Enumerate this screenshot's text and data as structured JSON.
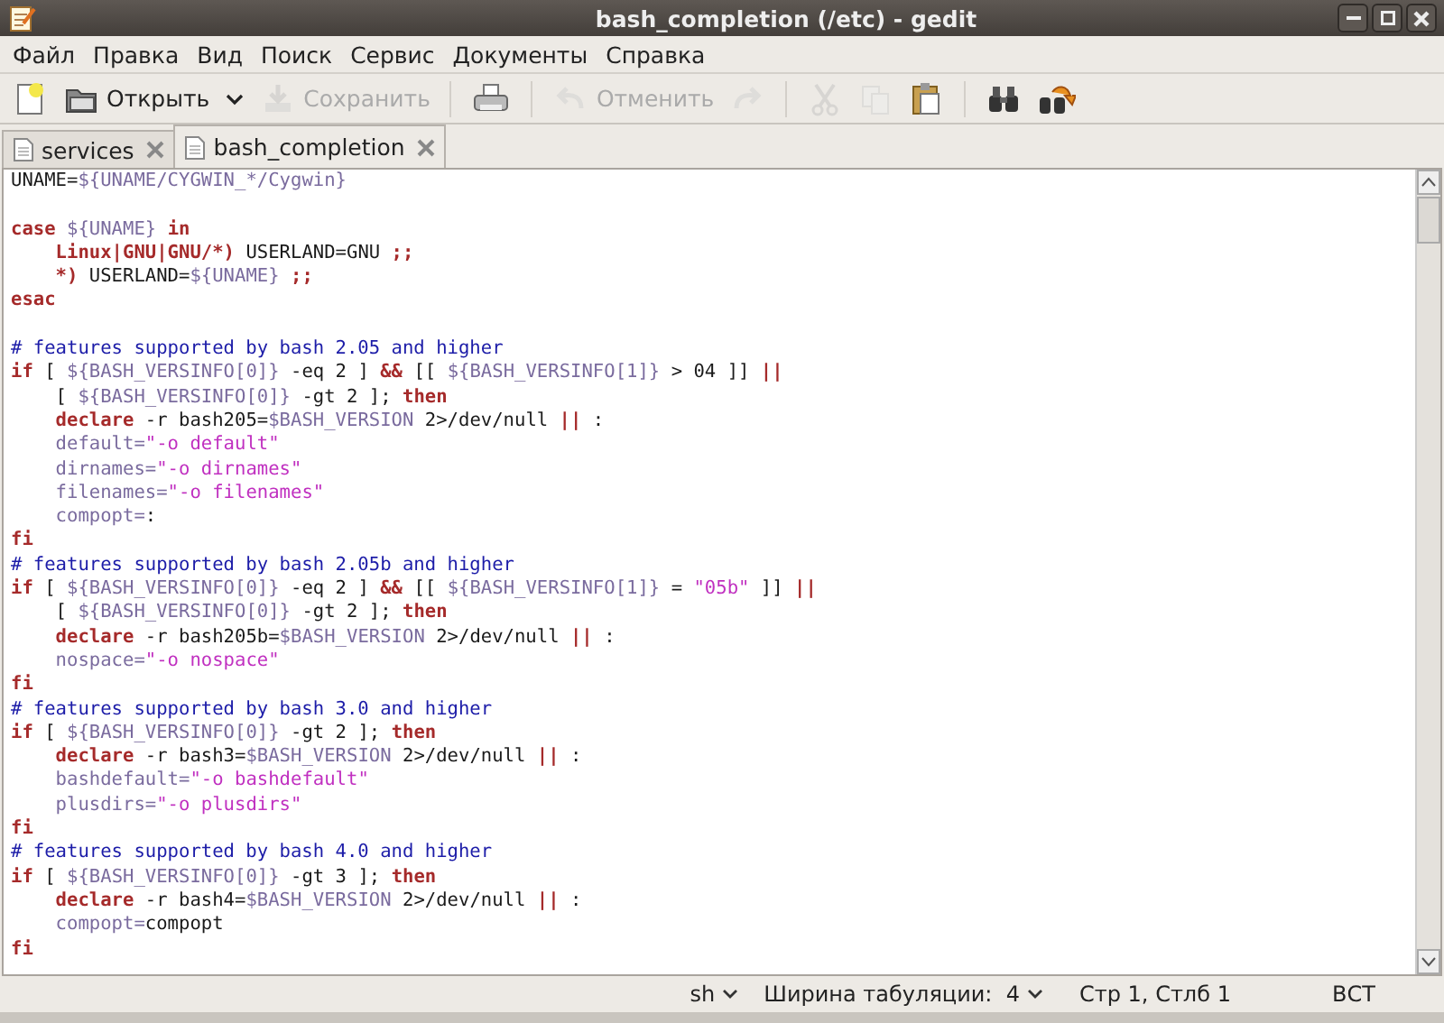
{
  "window": {
    "title": "bash_completion (/etc) - gedit"
  },
  "menu": [
    "Файл",
    "Правка",
    "Вид",
    "Поиск",
    "Сервис",
    "Документы",
    "Справка"
  ],
  "toolbar": [
    {
      "kind": "new",
      "disabled": false
    },
    {
      "kind": "open",
      "label": "Открыть",
      "disabled": false
    },
    {
      "kind": "save",
      "label": "Сохранить",
      "disabled": true
    },
    {
      "kind": "print",
      "disabled": false
    },
    {
      "kind": "undo",
      "label": "Отменить",
      "disabled": true
    },
    {
      "kind": "redo",
      "disabled": true
    },
    {
      "kind": "cut",
      "disabled": true
    },
    {
      "kind": "copy",
      "disabled": true
    },
    {
      "kind": "paste",
      "disabled": false
    },
    {
      "kind": "find",
      "disabled": false
    },
    {
      "kind": "replace",
      "disabled": false
    }
  ],
  "tabs": [
    {
      "label": "services",
      "selected": false
    },
    {
      "label": "bash_completion",
      "selected": true
    }
  ],
  "code": [
    {
      "kind": "code",
      "indent": false,
      "segments": [
        {
          "kind": "plain",
          "text": "UNAME="
        },
        {
          "kind": "var",
          "text": "${UNAME/CYGWIN_*/Cygwin}"
        }
      ]
    },
    {
      "kind": "blank"
    },
    {
      "kind": "code",
      "indent": false,
      "segments": [
        {
          "kind": "keyword",
          "text": "case"
        },
        {
          "kind": "var",
          "text": " ${UNAME} "
        },
        {
          "kind": "keyword",
          "text": "in"
        }
      ]
    },
    {
      "kind": "code",
      "indent": true,
      "segments": [
        {
          "kind": "keyword",
          "text": "Linux|GNU|GNU/*)"
        },
        {
          "kind": "plain",
          "text": " USERLAND=GNU "
        },
        {
          "kind": "keyword",
          "text": ";;"
        }
      ]
    },
    {
      "kind": "code",
      "indent": true,
      "segments": [
        {
          "kind": "keyword",
          "text": "*)"
        },
        {
          "kind": "plain",
          "text": " USERLAND="
        },
        {
          "kind": "var",
          "text": "${UNAME}"
        },
        {
          "kind": "keyword",
          "text": " ;;"
        }
      ]
    },
    {
      "kind": "code",
      "indent": false,
      "segments": [
        {
          "kind": "keyword",
          "text": "esac"
        }
      ]
    },
    {
      "kind": "blank"
    },
    {
      "kind": "code",
      "indent": false,
      "segments": [
        {
          "kind": "comment",
          "text": "# features supported by bash 2.05 and higher"
        }
      ]
    },
    {
      "kind": "code",
      "indent": false,
      "segments": [
        {
          "kind": "keyword",
          "text": "if"
        },
        {
          "kind": "plain",
          "text": " [ "
        },
        {
          "kind": "var",
          "text": "${BASH_VERSINFO[0]}"
        },
        {
          "kind": "plain",
          "text": " -eq 2 ] "
        },
        {
          "kind": "keyword",
          "text": "&&"
        },
        {
          "kind": "plain",
          "text": " [[ "
        },
        {
          "kind": "var",
          "text": "${BASH_VERSINFO[1]}"
        },
        {
          "kind": "plain",
          "text": " > 04 ]] "
        },
        {
          "kind": "keyword",
          "text": "||"
        }
      ]
    },
    {
      "kind": "code",
      "indent": true,
      "segments": [
        {
          "kind": "plain",
          "text": "[ "
        },
        {
          "kind": "var",
          "text": "${BASH_VERSINFO[0]}"
        },
        {
          "kind": "plain",
          "text": " -gt 2 ]; "
        },
        {
          "kind": "keyword",
          "text": "then"
        }
      ]
    },
    {
      "kind": "code",
      "indent": true,
      "segments": [
        {
          "kind": "keyword",
          "text": "declare"
        },
        {
          "kind": "plain",
          "text": " -r bash205="
        },
        {
          "kind": "var",
          "text": "$BASH_VERSION"
        },
        {
          "kind": "plain",
          "text": " 2>/dev/null "
        },
        {
          "kind": "keyword",
          "text": "||"
        },
        {
          "kind": "plain",
          "text": " :"
        }
      ]
    },
    {
      "kind": "code",
      "indent": true,
      "segments": [
        {
          "kind": "var",
          "text": "default="
        },
        {
          "kind": "string",
          "text": "\"-o default\""
        }
      ]
    },
    {
      "kind": "code",
      "indent": true,
      "segments": [
        {
          "kind": "var",
          "text": "dirnames="
        },
        {
          "kind": "string",
          "text": "\"-o dirnames\""
        }
      ]
    },
    {
      "kind": "code",
      "indent": true,
      "segments": [
        {
          "kind": "var",
          "text": "filenames="
        },
        {
          "kind": "string",
          "text": "\"-o filenames\""
        }
      ]
    },
    {
      "kind": "code",
      "indent": true,
      "segments": [
        {
          "kind": "var",
          "text": "compopt="
        },
        {
          "kind": "plain",
          "text": ":"
        }
      ]
    },
    {
      "kind": "code",
      "indent": false,
      "segments": [
        {
          "kind": "keyword",
          "text": "fi"
        }
      ]
    },
    {
      "kind": "code",
      "indent": false,
      "segments": [
        {
          "kind": "comment",
          "text": "# features supported by bash 2.05b and higher"
        }
      ]
    },
    {
      "kind": "code",
      "indent": false,
      "segments": [
        {
          "kind": "keyword",
          "text": "if"
        },
        {
          "kind": "plain",
          "text": " [ "
        },
        {
          "kind": "var",
          "text": "${BASH_VERSINFO[0]}"
        },
        {
          "kind": "plain",
          "text": " -eq 2 ] "
        },
        {
          "kind": "keyword",
          "text": "&&"
        },
        {
          "kind": "plain",
          "text": " [[ "
        },
        {
          "kind": "var",
          "text": "${BASH_VERSINFO[1]}"
        },
        {
          "kind": "plain",
          "text": " = "
        },
        {
          "kind": "string",
          "text": "\"05b\""
        },
        {
          "kind": "plain",
          "text": " ]] "
        },
        {
          "kind": "keyword",
          "text": "||"
        }
      ]
    },
    {
      "kind": "code",
      "indent": true,
      "segments": [
        {
          "kind": "plain",
          "text": "[ "
        },
        {
          "kind": "var",
          "text": "${BASH_VERSINFO[0]}"
        },
        {
          "kind": "plain",
          "text": " -gt 2 ]; "
        },
        {
          "kind": "keyword",
          "text": "then"
        }
      ]
    },
    {
      "kind": "code",
      "indent": true,
      "segments": [
        {
          "kind": "keyword",
          "text": "declare"
        },
        {
          "kind": "plain",
          "text": " -r bash205b="
        },
        {
          "kind": "var",
          "text": "$BASH_VERSION"
        },
        {
          "kind": "plain",
          "text": " 2>/dev/null "
        },
        {
          "kind": "keyword",
          "text": "||"
        },
        {
          "kind": "plain",
          "text": " :"
        }
      ]
    },
    {
      "kind": "code",
      "indent": true,
      "segments": [
        {
          "kind": "var",
          "text": "nospace="
        },
        {
          "kind": "string",
          "text": "\"-o nospace\""
        }
      ]
    },
    {
      "kind": "code",
      "indent": false,
      "segments": [
        {
          "kind": "keyword",
          "text": "fi"
        }
      ]
    },
    {
      "kind": "code",
      "indent": false,
      "segments": [
        {
          "kind": "comment",
          "text": "# features supported by bash 3.0 and higher"
        }
      ]
    },
    {
      "kind": "code",
      "indent": false,
      "segments": [
        {
          "kind": "keyword",
          "text": "if"
        },
        {
          "kind": "plain",
          "text": " [ "
        },
        {
          "kind": "var",
          "text": "${BASH_VERSINFO[0]}"
        },
        {
          "kind": "plain",
          "text": " -gt 2 ]; "
        },
        {
          "kind": "keyword",
          "text": "then"
        }
      ]
    },
    {
      "kind": "code",
      "indent": true,
      "segments": [
        {
          "kind": "keyword",
          "text": "declare"
        },
        {
          "kind": "plain",
          "text": " -r bash3="
        },
        {
          "kind": "var",
          "text": "$BASH_VERSION"
        },
        {
          "kind": "plain",
          "text": " 2>/dev/null "
        },
        {
          "kind": "keyword",
          "text": "||"
        },
        {
          "kind": "plain",
          "text": " :"
        }
      ]
    },
    {
      "kind": "code",
      "indent": true,
      "segments": [
        {
          "kind": "var",
          "text": "bashdefault="
        },
        {
          "kind": "string",
          "text": "\"-o bashdefault\""
        }
      ]
    },
    {
      "kind": "code",
      "indent": true,
      "segments": [
        {
          "kind": "var",
          "text": "plusdirs="
        },
        {
          "kind": "string",
          "text": "\"-o plusdirs\""
        }
      ]
    },
    {
      "kind": "code",
      "indent": false,
      "segments": [
        {
          "kind": "keyword",
          "text": "fi"
        }
      ]
    },
    {
      "kind": "code",
      "indent": false,
      "segments": [
        {
          "kind": "comment",
          "text": "# features supported by bash 4.0 and higher"
        }
      ]
    },
    {
      "kind": "code",
      "indent": false,
      "segments": [
        {
          "kind": "keyword",
          "text": "if"
        },
        {
          "kind": "plain",
          "text": " [ "
        },
        {
          "kind": "var",
          "text": "${BASH_VERSINFO[0]}"
        },
        {
          "kind": "plain",
          "text": " -gt 3 ]; "
        },
        {
          "kind": "keyword",
          "text": "then"
        }
      ]
    },
    {
      "kind": "code",
      "indent": true,
      "segments": [
        {
          "kind": "keyword",
          "text": "declare"
        },
        {
          "kind": "plain",
          "text": " -r bash4="
        },
        {
          "kind": "var",
          "text": "$BASH_VERSION"
        },
        {
          "kind": "plain",
          "text": " 2>/dev/null "
        },
        {
          "kind": "keyword",
          "text": "||"
        },
        {
          "kind": "plain",
          "text": " :"
        }
      ]
    },
    {
      "kind": "code",
      "indent": true,
      "segments": [
        {
          "kind": "var",
          "text": "compopt="
        },
        {
          "kind": "plain",
          "text": "compopt"
        }
      ]
    },
    {
      "kind": "code",
      "indent": false,
      "segments": [
        {
          "kind": "keyword",
          "text": "fi"
        }
      ]
    }
  ],
  "status_bar": {
    "language": "sh",
    "tab_width": "Ширина табуляции:  4",
    "position": "Стр 1, Стлб 1",
    "mode": "ВСТ"
  }
}
